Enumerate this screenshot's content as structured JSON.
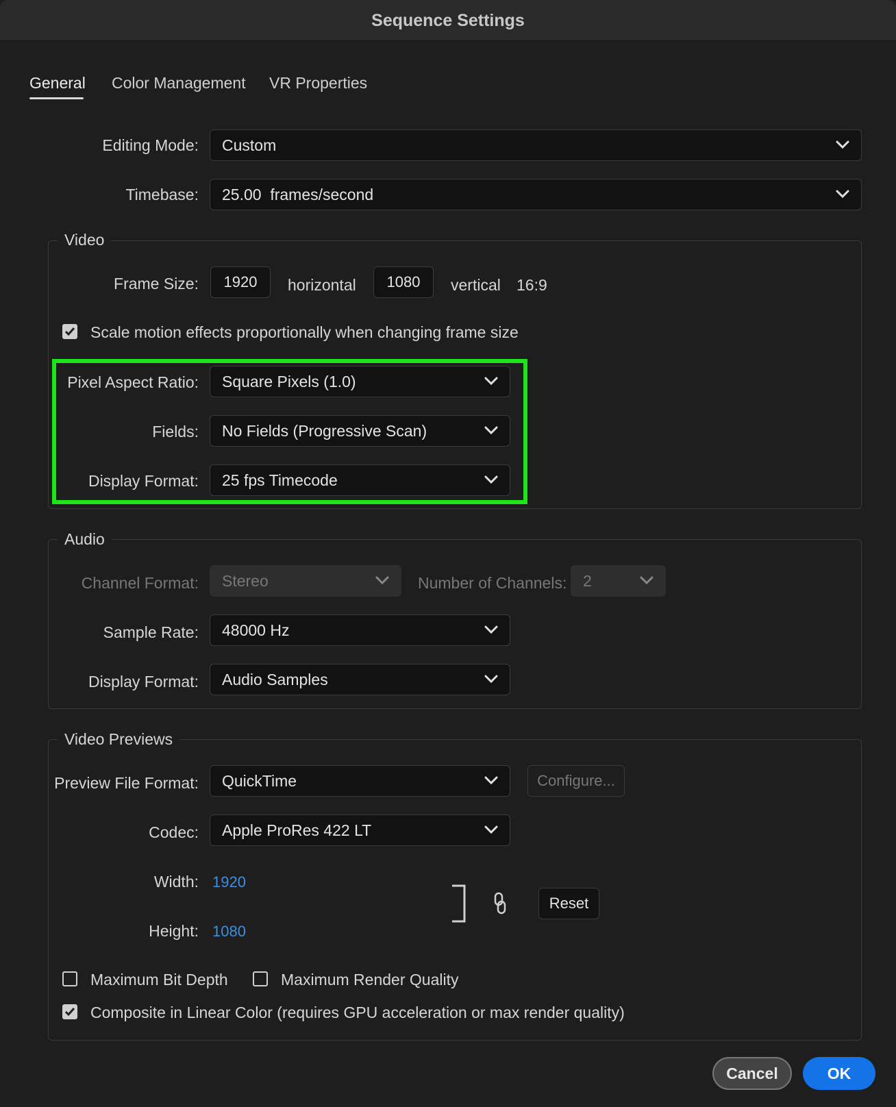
{
  "window": {
    "title": "Sequence Settings"
  },
  "tabs": [
    {
      "label": "General",
      "active": true
    },
    {
      "label": "Color Management",
      "active": false
    },
    {
      "label": "VR Properties",
      "active": false
    }
  ],
  "general": {
    "editing_mode": {
      "label": "Editing Mode:",
      "value": "Custom"
    },
    "timebase": {
      "label": "Timebase:",
      "value": "25.00  frames/second"
    }
  },
  "video": {
    "title": "Video",
    "frame_size": {
      "label": "Frame Size:",
      "horizontal_value": "1920",
      "horizontal_label": "horizontal",
      "vertical_value": "1080",
      "vertical_label": "vertical",
      "aspect": "16:9"
    },
    "scale_motion": {
      "label": "Scale motion effects proportionally when changing frame size",
      "checked": true
    },
    "pixel_aspect_ratio": {
      "label": "Pixel Aspect Ratio:",
      "value": "Square Pixels (1.0)"
    },
    "fields": {
      "label": "Fields:",
      "value": "No Fields (Progressive Scan)"
    },
    "display_format": {
      "label": "Display Format:",
      "value": "25 fps Timecode"
    },
    "highlight_color": "#1ee41a"
  },
  "audio": {
    "title": "Audio",
    "channel_format": {
      "label": "Channel Format:",
      "value": "Stereo"
    },
    "number_of_channels": {
      "label": "Number of Channels:",
      "value": "2"
    },
    "sample_rate": {
      "label": "Sample Rate:",
      "value": "48000 Hz"
    },
    "display_format": {
      "label": "Display Format:",
      "value": "Audio Samples"
    }
  },
  "video_previews": {
    "title": "Video Previews",
    "preview_file_format": {
      "label": "Preview File Format:",
      "value": "QuickTime"
    },
    "configure_label": "Configure...",
    "codec": {
      "label": "Codec:",
      "value": "Apple ProRes 422 LT"
    },
    "width": {
      "label": "Width:",
      "value": "1920"
    },
    "height": {
      "label": "Height:",
      "value": "1080"
    },
    "reset_label": "Reset",
    "max_bit_depth": {
      "label": "Maximum Bit Depth",
      "checked": false
    },
    "max_render_quality": {
      "label": "Maximum Render Quality",
      "checked": false
    },
    "composite_linear": {
      "label": "Composite in Linear Color (requires GPU acceleration or max render quality)",
      "checked": true
    }
  },
  "footer": {
    "cancel_label": "Cancel",
    "ok_label": "OK",
    "ok_color": "#1473e6"
  }
}
